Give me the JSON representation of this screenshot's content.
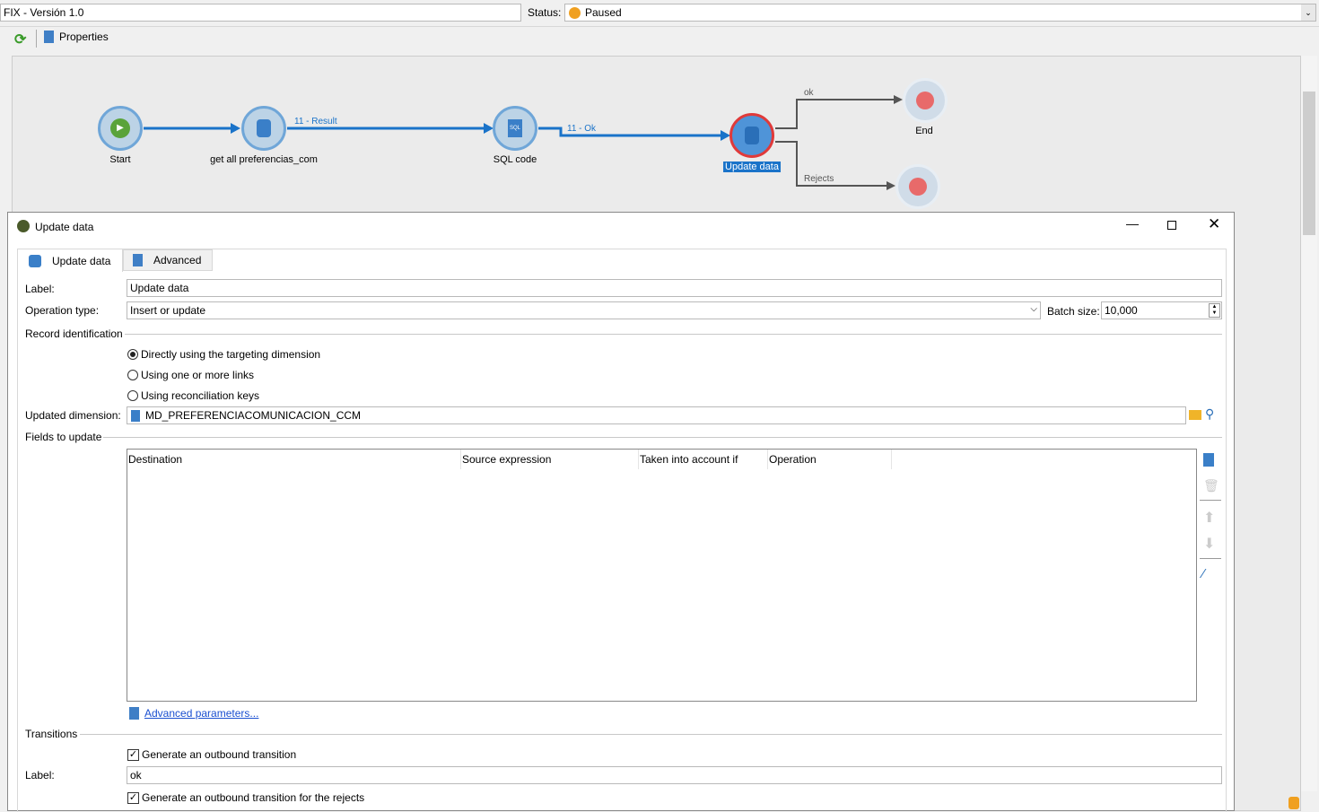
{
  "header": {
    "title": "FIX - Versión 1.0",
    "status_label": "Status:",
    "status_value": "Paused"
  },
  "toolbar": {
    "properties": "Properties"
  },
  "workflow": {
    "nodes": {
      "start": "Start",
      "query": "get all preferencias_com",
      "sql": "SQL code",
      "update": "Update data",
      "end": "End"
    },
    "transitions": {
      "result": "11 - Result",
      "ok11": "11 - Ok",
      "ok": "ok",
      "rejects": "Rejects"
    }
  },
  "dialog": {
    "title": "Update data",
    "tabs": [
      {
        "label": "Update data"
      },
      {
        "label": "Advanced"
      }
    ],
    "label_caption": "Label:",
    "label_value": "Update data",
    "operation_caption": "Operation type:",
    "operation_value": "Insert or update",
    "batch_caption": "Batch size:",
    "batch_value": "10,000",
    "record_id_caption": "Record identification",
    "record_options": [
      "Directly using the targeting dimension",
      "Using one or more links",
      "Using reconciliation keys"
    ],
    "dimension_caption": "Updated dimension:",
    "dimension_value": "MD_PREFERENCIACOMUNICACION_CCM",
    "fields_caption": "Fields to update",
    "columns": [
      "Destination",
      "Source expression",
      "Taken into account if",
      "Operation"
    ],
    "advanced_link": "Advanced parameters...",
    "transitions_caption": "Transitions",
    "gen_outbound": "Generate an outbound transition",
    "transition_label_caption": "Label:",
    "transition_label_value": "ok",
    "gen_rejects": "Generate an outbound transition for the rejects"
  }
}
